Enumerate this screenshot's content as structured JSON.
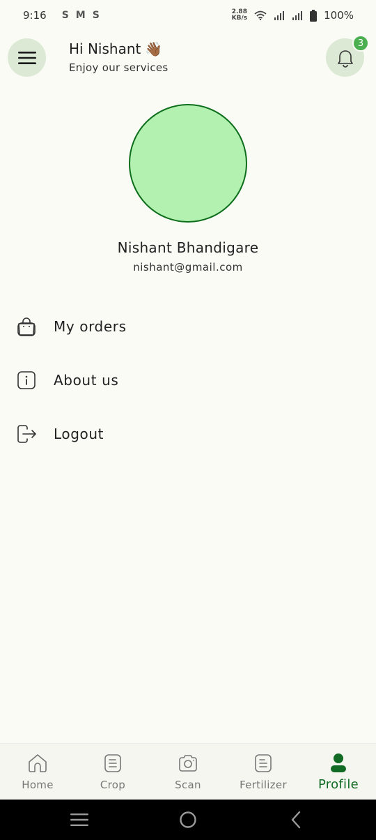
{
  "status_bar": {
    "time": "9:16",
    "app_icons": [
      "S",
      "M",
      "S"
    ],
    "speed_value": "2.88",
    "speed_unit": "KB/s",
    "battery": "100%"
  },
  "header": {
    "greeting": "Hi Nishant",
    "greeting_emoji": "👋🏾",
    "subtitle": "Enjoy our services",
    "notification_count": "3"
  },
  "profile": {
    "name": "Nishant Bhandigare",
    "email": "nishant@gmail.com"
  },
  "menu": [
    {
      "label": "My orders",
      "icon": "shopping-bag-icon"
    },
    {
      "label": "About us",
      "icon": "info-icon"
    },
    {
      "label": "Logout",
      "icon": "logout-icon"
    }
  ],
  "bottom_nav": {
    "active": "Profile",
    "items": [
      {
        "label": "Home",
        "icon": "home-icon"
      },
      {
        "label": "Crop",
        "icon": "document-icon"
      },
      {
        "label": "Scan",
        "icon": "camera-icon"
      },
      {
        "label": "Fertilizer",
        "icon": "document-icon"
      },
      {
        "label": "Profile",
        "icon": "person-icon"
      }
    ]
  },
  "colors": {
    "background": "#fafbf5",
    "accent": "#116b25",
    "avatar_fill": "#b3f1b0",
    "chip_bg": "#dbe9d5",
    "badge": "#4caf50"
  }
}
